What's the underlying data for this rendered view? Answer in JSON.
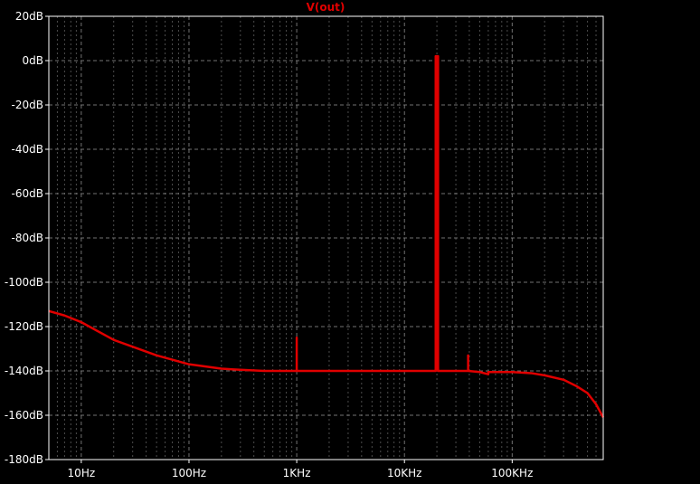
{
  "chart_data": {
    "type": "line",
    "title": "V(out)",
    "x_scale": "log",
    "xlim": [
      5,
      700000
    ],
    "ylim": [
      -180,
      20
    ],
    "grid": true,
    "x_ticks": [
      {
        "value": 10,
        "label": "10Hz"
      },
      {
        "value": 100,
        "label": "100Hz"
      },
      {
        "value": 1000,
        "label": "1KHz"
      },
      {
        "value": 10000,
        "label": "10KHz"
      },
      {
        "value": 100000,
        "label": "100KHz"
      }
    ],
    "y_ticks": [
      {
        "value": 20,
        "label": "20dB"
      },
      {
        "value": 0,
        "label": "0dB"
      },
      {
        "value": -20,
        "label": "-20dB"
      },
      {
        "value": -40,
        "label": "-40dB"
      },
      {
        "value": -60,
        "label": "-60dB"
      },
      {
        "value": -80,
        "label": "-80dB"
      },
      {
        "value": -100,
        "label": "-100dB"
      },
      {
        "value": -120,
        "label": "-120dB"
      },
      {
        "value": -140,
        "label": "-140dB"
      },
      {
        "value": -160,
        "label": "-160dB"
      },
      {
        "value": -180,
        "label": "-180dB"
      }
    ],
    "colors": {
      "background": "#000000",
      "trace": "#e00000",
      "grid": "#7f7f7f",
      "frame": "#ffffff"
    },
    "series": [
      {
        "name": "V(out)",
        "x": [
          5,
          7,
          10,
          20,
          50,
          100,
          200,
          300,
          500,
          1000,
          1000,
          1000,
          2000,
          5000,
          10000,
          19500,
          19500,
          20500,
          20500,
          30000,
          39000,
          39000,
          39000,
          50000,
          60000,
          60000,
          60000,
          80000,
          100000,
          150000,
          200000,
          300000,
          400000,
          500000,
          600000,
          700000
        ],
        "y": [
          -113,
          -115,
          -118,
          -126,
          -133,
          -137,
          -139,
          -139.5,
          -140,
          -140,
          -125,
          -140,
          -140,
          -140,
          -140,
          -140,
          2,
          2,
          -140,
          -140,
          -140,
          -133,
          -140,
          -140.5,
          -141.5,
          -140.5,
          -140.5,
          -140.5,
          -140.5,
          -141,
          -142,
          -144,
          -147,
          -150,
          -155,
          -161
        ]
      }
    ]
  }
}
